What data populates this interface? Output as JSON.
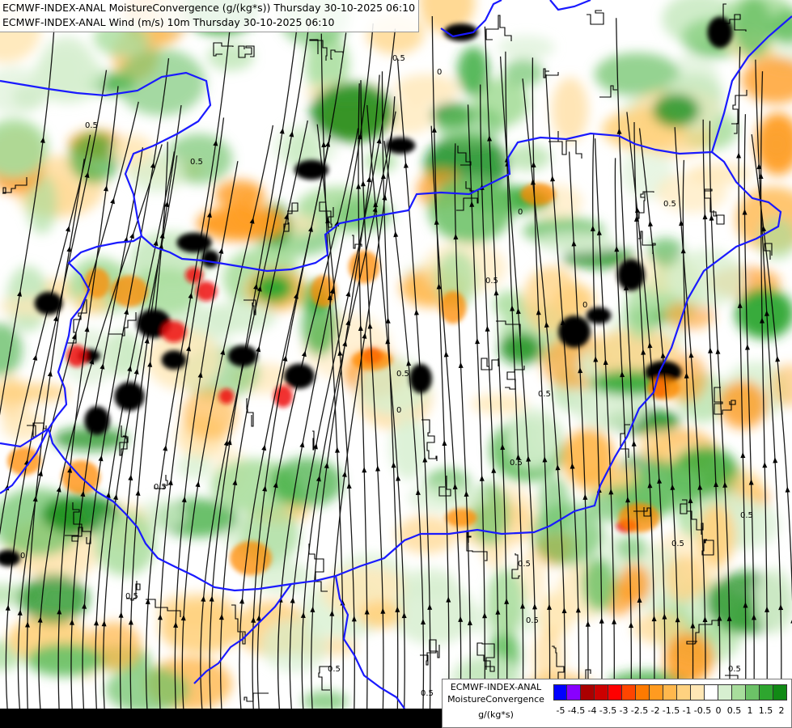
{
  "header": {
    "line1": "ECMWF-INDEX-ANAL MoistureConvergence (g/(kg*s)) Thursday 30-10-2025 06:10",
    "line2": "ECMWF-INDEX-ANAL Wind (m/s) 10m Thursday 30-10-2025 06:10"
  },
  "legend": {
    "model": "ECMWF-INDEX-ANAL",
    "parameter": "MoistureConvergence",
    "unit": "g/(kg*s)",
    "colors": [
      "#0000ff",
      "#8800ff",
      "#aa0000",
      "#cc0000",
      "#ff0000",
      "#ff4500",
      "#ff7a00",
      "#ff9b20",
      "#ffb84d",
      "#ffd280",
      "#ffe7b5",
      "#ffffff",
      "#d7efd0",
      "#a8dd9c",
      "#6cc267",
      "#2ea62f",
      "#118a15"
    ],
    "ticks": [
      "-5",
      "-4.5",
      "-4",
      "-3.5",
      "-3",
      "-2.5",
      "-2",
      "-1.5",
      "-1",
      "-0.5",
      "0",
      "0.5",
      "1",
      "1.5",
      "2"
    ]
  },
  "map": {
    "contour_labels": [
      "0.5",
      "0",
      "0.5",
      "0.5",
      "0",
      "0.5",
      "0",
      "0.5",
      "0.5",
      "0",
      "0.5",
      "0.5",
      "0.5",
      "0.5",
      "0.5",
      "0.5",
      "0.5",
      "0.5",
      "0.5",
      "0.5",
      "0",
      "0.5"
    ]
  }
}
